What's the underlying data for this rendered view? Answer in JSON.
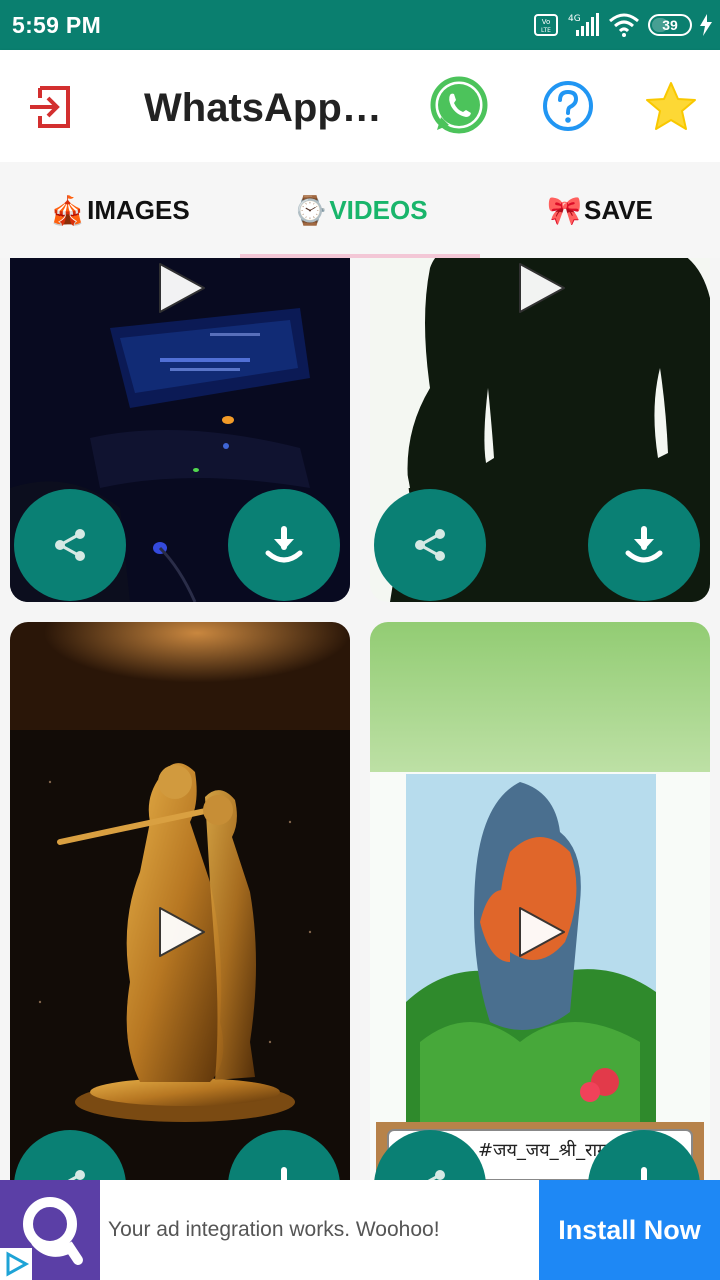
{
  "status_bar": {
    "time": "5:59 PM",
    "battery_level": "39",
    "network": "4G"
  },
  "app_bar": {
    "title": "WhatsApp…",
    "icons": [
      "exit-icon",
      "whatsapp-icon",
      "help-icon",
      "star-icon"
    ]
  },
  "tabs": [
    {
      "emoji": "🎪",
      "label": "IMAGES",
      "selected": false
    },
    {
      "emoji": "⌚",
      "label": "VIDEOS",
      "selected": true
    },
    {
      "emoji": "🎀",
      "label": "SAVE",
      "selected": false
    }
  ],
  "videos": [
    {
      "name": "car-dashboard-night"
    },
    {
      "name": "silhouette-portrait"
    },
    {
      "name": "radha-krishna-statue"
    },
    {
      "name": "hanuman-idol",
      "caption": "#जय_जय_श्री_राम"
    }
  ],
  "ad": {
    "text": "Your ad integration works. Woohoo!",
    "button_label": "Install Now"
  },
  "colors": {
    "status_bar": "#0a7f6f",
    "fab": "#0a8074",
    "tab_selected": "#19b56b",
    "install_button": "#1e88f5",
    "ad_logo": "#5b3fa6"
  }
}
